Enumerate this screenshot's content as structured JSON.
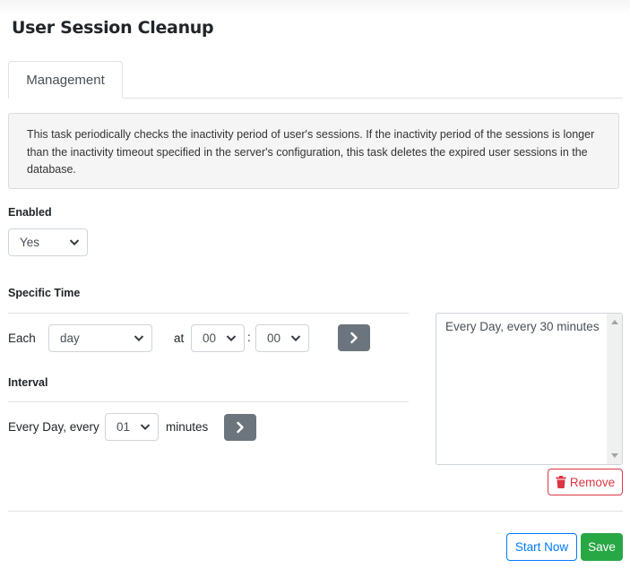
{
  "page": {
    "title": "User Session Cleanup"
  },
  "tabs": [
    {
      "label": "Management",
      "active": true
    }
  ],
  "description": "This task periodically checks the inactivity period of user's sessions. If the inactivity period of the sessions is longer than the inactivity timeout specified in the server's configuration, this task deletes the expired user sessions in the database.",
  "enabled": {
    "label": "Enabled",
    "value": "Yes"
  },
  "specific_time": {
    "label": "Specific Time",
    "each_label": "Each",
    "each_value": "day",
    "at_label": "at",
    "hour_value": "00",
    "separator": ":",
    "minute_value": "00",
    "add_icon": "chevron-right-icon"
  },
  "interval": {
    "label": "Interval",
    "prefix": "Every Day, every",
    "value": "01",
    "suffix": "minutes",
    "add_icon": "chevron-right-icon"
  },
  "schedules": {
    "items": [
      "Every Day, every 30 minutes"
    ]
  },
  "buttons": {
    "remove": "Remove",
    "start_now": "Start Now",
    "save": "Save"
  },
  "colors": {
    "primary": "#007bff",
    "success": "#28a745",
    "danger": "#dc3545",
    "secondary": "#6c757d"
  }
}
